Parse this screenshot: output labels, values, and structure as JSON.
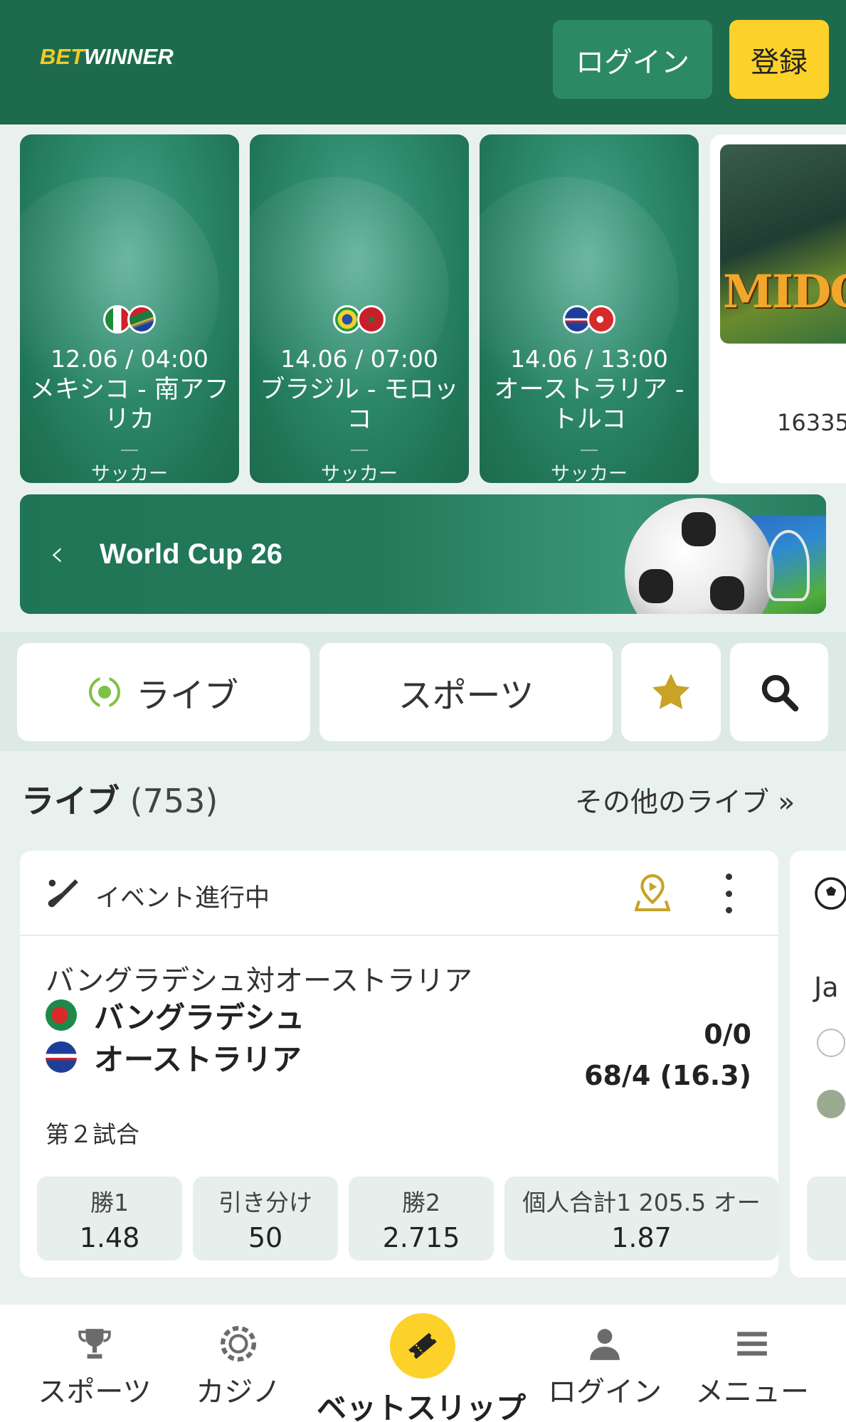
{
  "header": {
    "logo_bet": "BET",
    "logo_winner": "WINNER",
    "login_label": "ログイン",
    "register_label": "登録"
  },
  "banners": [
    {
      "datetime": "12.06 / 04:00",
      "teams": "メキシコ - 南アフリカ",
      "sport": "サッカー"
    },
    {
      "datetime": "14.06 / 07:00",
      "teams": "ブラジル - モロッコ",
      "sport": "サッカー"
    },
    {
      "datetime": "14.06 / 13:00",
      "teams": "オーストラリア - トルコ",
      "sport": "サッカー"
    }
  ],
  "game_card": {
    "title": "MIDGA",
    "count": "16335"
  },
  "world_cup": {
    "title": "World Cup 26"
  },
  "nav_pills": {
    "live": "ライブ",
    "sports": "スポーツ"
  },
  "live_section": {
    "label": "ライブ",
    "count": "(753)",
    "more": "その他のライブ »"
  },
  "event": {
    "status": "イベント進行中",
    "title": "バングラデシュ対オーストラリア",
    "team1": {
      "name": "バングラデシュ",
      "score": "0/0"
    },
    "team2": {
      "name": "オーストラリア",
      "score": "68/4 (16.3)"
    },
    "game_number": "第２試合",
    "odds": [
      {
        "label": "勝1",
        "value": "1.48"
      },
      {
        "label": "引き分け",
        "value": "50"
      },
      {
        "label": "勝2",
        "value": "2.715"
      },
      {
        "label": "個人合計1 205.5 オー",
        "value": "1.87"
      }
    ]
  },
  "event2": {
    "title_partial": "Ja"
  },
  "bottom_nav": {
    "sports": "スポーツ",
    "casino": "カジノ",
    "betslip": "ベットスリップ",
    "login": "ログイン",
    "menu": "メニュー"
  },
  "colors": {
    "header_green": "#1d6b4c",
    "accent_yellow": "#fcd12a",
    "live_green": "#7dc242",
    "star_gold": "#c9a227"
  }
}
